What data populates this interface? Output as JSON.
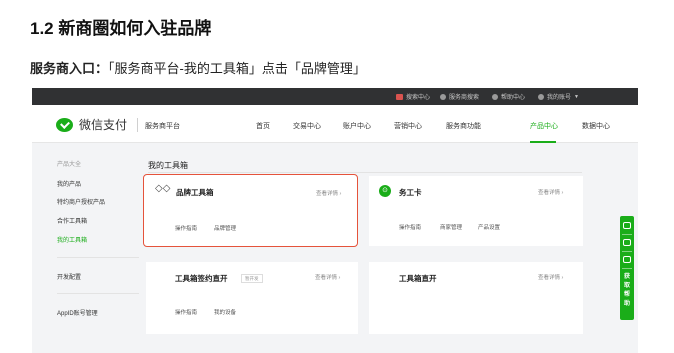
{
  "doc": {
    "title": "1.2 新商圈如何入驻品牌",
    "entry_label": "服务商入口：",
    "entry_text": "「服务商平台-我的工具箱」点击「品牌管理」"
  },
  "topbar": {
    "items": [
      "搜索中心",
      "服务商搜索",
      "帮助中心",
      "我的账号"
    ]
  },
  "navbar": {
    "logo_text": "微信支付",
    "platform": "服务商平台",
    "items": [
      "首页",
      "交易中心",
      "账户中心",
      "营销中心",
      "服务商功能",
      "产品中心",
      "数据中心"
    ],
    "active_index": 5
  },
  "sidebar": {
    "section_header": "产品大全",
    "items": [
      "我的产品",
      "特约商户授权产品",
      "合作工具箱",
      "我的工具箱"
    ],
    "active_item": "我的工具箱",
    "item_dev": "开发配置",
    "item_appid": "AppID账号管理"
  },
  "content": {
    "title": "我的工具箱",
    "cards": [
      {
        "title": "品牌工具箱",
        "link": "查看详情 ›",
        "subs": [
          "操作指南",
          "品牌管理"
        ],
        "highlighted": true
      },
      {
        "title": "务工卡",
        "link": "查看详情 ›",
        "subs": [
          "操作指南",
          "商家管理",
          "产品设置"
        ]
      },
      {
        "title": "工具箱签约直开",
        "badge": "暂开发",
        "link": "查看详情 ›",
        "subs": [
          "操作指南",
          "我的设备"
        ]
      },
      {
        "title": "工具箱直开",
        "link": "查看详情 ›",
        "subs": []
      }
    ]
  },
  "float_help": {
    "label": "获取帮助"
  },
  "colors": {
    "brand_green": "#1aad19",
    "highlight_red": "#e5533b",
    "topbar_bg": "#303133"
  }
}
